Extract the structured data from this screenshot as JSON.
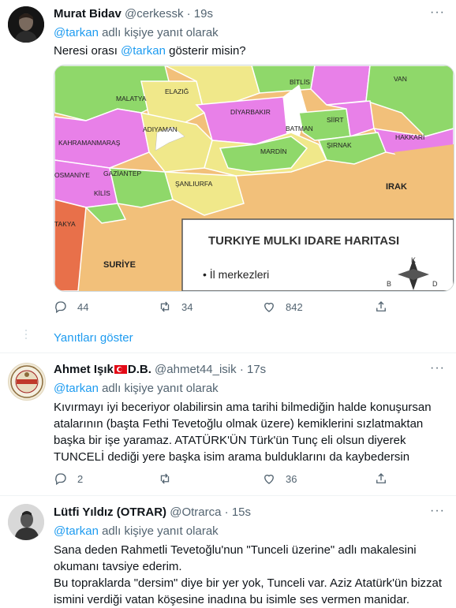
{
  "tweets": [
    {
      "name": "Murat Bidav",
      "handle": "@cerkessk",
      "time": "19s",
      "reply_prefix": "@tarkan",
      "reply_suffix": " adlı kişiye yanıt olarak",
      "text_a": "Neresi orası ",
      "text_mention": "@tarkan",
      "text_b": " gösterir misin?",
      "replies": "44",
      "retweets": "34",
      "likes": "842"
    },
    {
      "name_a": "Ahmet Işık",
      "name_b": "D.B.",
      "handle": "@ahmet44_isik",
      "time": "17s",
      "reply_prefix": "@tarkan",
      "reply_suffix": " adlı kişiye yanıt olarak",
      "lines": [
        "Kıvırmayı iyi beceriyor olabilirsin ama tarihi bilmediğin halde konuşursan",
        "atalarının (başta Fethi Tevetoğlu olmak üzere) kemiklerini sızlatmaktan",
        "başka bir işe yaramaz. ATATÜRK'ÜN Türk'ün Tunç eli olsun diyerek",
        "TUNCELİ dediği yere başka isim arama bulduklarını da kaybedersin"
      ],
      "replies": "2",
      "retweets": "",
      "likes": "36"
    },
    {
      "name": "Lütfi Yıldız (OTRAR)",
      "handle": "@Otrarca",
      "time": "15s",
      "reply_prefix": "@tarkan",
      "reply_suffix": " adlı kişiye yanıt olarak",
      "lines": [
        "Sana deden Rahmetli Tevetoğlu'nun \"Tunceli üzerine\" adlı makalesini",
        "okumanı tavsiye ederim.",
        "Bu topraklarda \"dersim\" diye bir yer yok, Tunceli var. Aziz Atatürk'ün bizzat",
        "ismini verdiği vatan köşesine inadına bu isimle ses vermen manidar."
      ]
    }
  ],
  "show_replies": "Yanıtları göster",
  "separator": "·",
  "more_icon": "more-icon",
  "map": {
    "cities": [
      "BİTLİS",
      "VAN",
      "MALATYA",
      "ELAZIĞ",
      "DİYARBAKIR",
      "SİİRT",
      "ADIYAMAN",
      "BATMAN",
      "KAHRAMANMARAŞ",
      "ŞIRNAK",
      "HAKKARİ",
      "MARDİN",
      "OSMANİYE",
      "GAZİANTEP",
      "ŞANLIURFA",
      "KİLİS",
      "IRAK",
      "SURİYE",
      "TAKYA"
    ],
    "legend_title": "TURKIYE MULKI IDARE HARITASI",
    "legend_item": "• İl merkezleri",
    "compass": [
      "K",
      "B",
      "D"
    ]
  },
  "colors": {
    "accent": "#1d9bf0",
    "muted": "#536471"
  }
}
